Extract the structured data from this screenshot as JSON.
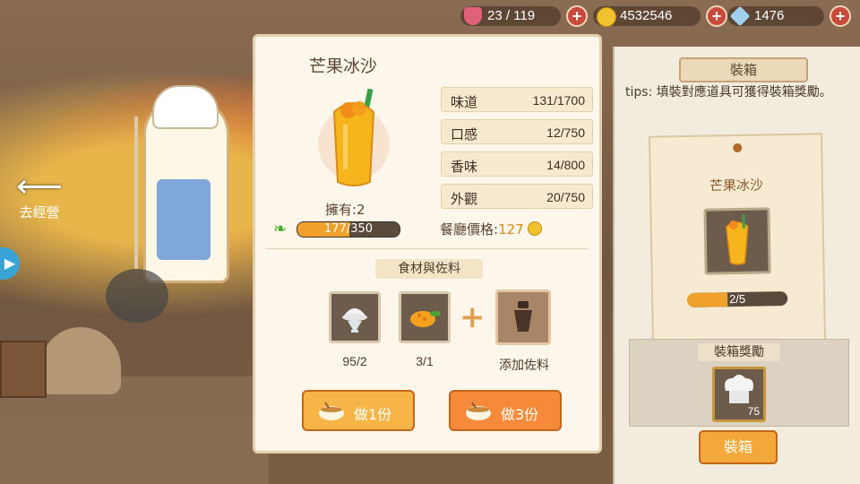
{
  "resources": {
    "hearts": "23 / 119",
    "coins": "4532546",
    "gems": "1476"
  },
  "nav": {
    "back_label": "去經營"
  },
  "dish": {
    "name": "芒果冰沙",
    "owned": "擁有:2",
    "exp_current": "177",
    "exp_sep": "/",
    "exp_max": "350",
    "exp_fraction": 0.506,
    "stats": [
      {
        "name": "味道",
        "value": "131/1700"
      },
      {
        "name": "口感",
        "value": "12/750"
      },
      {
        "name": "香味",
        "value": "14/800"
      },
      {
        "name": "外觀",
        "value": "20/750"
      }
    ],
    "price_label": "餐廳價格:",
    "price_value": "127"
  },
  "ingredients": {
    "header": "食材與佐料",
    "items": [
      {
        "icon": "ice-cream-icon",
        "count": "95/2"
      },
      {
        "icon": "mango-icon",
        "count": "3/1"
      }
    ],
    "seasoning_label": "添加佐料"
  },
  "actions": {
    "cook_one": "做1份",
    "cook_three": "做3份"
  },
  "showcase": {
    "title": "裝箱",
    "tips": "tips: 填裝對應道具可獲得裝箱獎勵。",
    "card_title": "芒果冰沙",
    "progress_text": "2/5",
    "progress_fraction": 0.4,
    "reward_title": "裝箱獎勵",
    "reward_count": "75",
    "button": "裝箱"
  },
  "colors": {
    "accent_orange": "#f5a83a",
    "exp_fill": "#f0a12b",
    "panel_bg": "#fdf6ea",
    "price_orange": "#d98a18"
  }
}
